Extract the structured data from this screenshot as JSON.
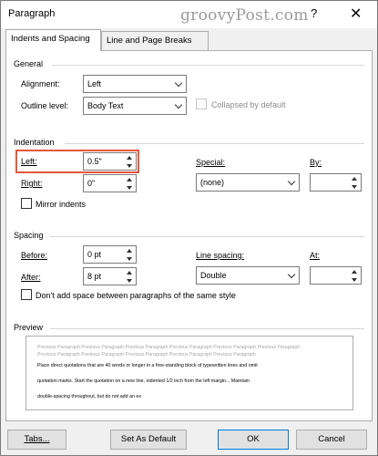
{
  "window": {
    "title": "Paragraph",
    "watermark": "groovyPost.com",
    "help": "?",
    "close": "✕"
  },
  "tabs": [
    {
      "label": "Indents and Spacing",
      "active": true
    },
    {
      "label": "Line and Page Breaks",
      "active": false
    }
  ],
  "general": {
    "title": "General",
    "alignment_label": "Alignment:",
    "alignment_value": "Left",
    "outline_label": "Outline level:",
    "outline_value": "Body Text",
    "collapsed_label": "Collapsed by default"
  },
  "indentation": {
    "title": "Indentation",
    "left_label": "Left:",
    "left_value": "0.5\"",
    "right_label": "Right:",
    "right_value": "0\"",
    "special_label": "Special:",
    "special_value": "(none)",
    "by_label": "By:",
    "by_value": "",
    "mirror_label": "Mirror indents"
  },
  "spacing": {
    "title": "Spacing",
    "before_label": "Before:",
    "before_value": "0 pt",
    "after_label": "After:",
    "after_value": "8 pt",
    "line_spacing_label": "Line spacing:",
    "line_spacing_value": "Double",
    "at_label": "At:",
    "at_value": "",
    "dont_add_label": "Don't add space between paragraphs of the same style"
  },
  "preview": {
    "title": "Preview",
    "prev_line1": "Previous Paragraph Previous Paragraph Previous Paragraph Previous Paragraph Previous Paragraph Previous Paragraph",
    "prev_line2": "Previous Paragraph Previous Paragraph Previous Paragraph Previous Paragraph Previous Paragraph",
    "line1": "Place direct quotations that are 40 words or longer in a free-standing block of typewritten lines and omit",
    "line2": "quotation marks. Start the quotation on a new line, indented 1/2 inch from the left margin... Maintain",
    "line3": "double-spacing throughout, but do not add an ex"
  },
  "buttons": {
    "tabs": "Tabs...",
    "default": "Set As Default",
    "ok": "OK",
    "cancel": "Cancel"
  },
  "colors": {
    "highlight": "#e2583e",
    "dialog_bg": "#f0f0f0"
  }
}
